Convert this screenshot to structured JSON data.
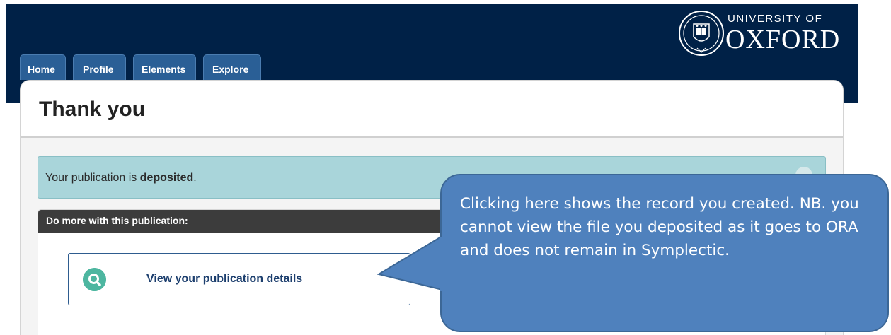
{
  "header": {
    "logo": {
      "line1": "UNIVERSITY OF",
      "line2": "OXFORD"
    }
  },
  "nav": {
    "tabs": [
      {
        "label": "Home"
      },
      {
        "label": "Profile"
      },
      {
        "label": "Elements"
      },
      {
        "label": "Explore"
      }
    ]
  },
  "main": {
    "title": "Thank you",
    "alert": {
      "prefix": "Your publication is ",
      "bold": "deposited",
      "suffix": "."
    },
    "more": {
      "title": "Do more with this publication:",
      "action_label": "View your publication details",
      "action_icon": "search-icon"
    }
  },
  "callout": {
    "text": "Clicking here shows the record you created. NB. you cannot view the file you deposited as it goes to ORA and does not remain in Symplectic."
  },
  "colors": {
    "brand_dark": "#002147",
    "tab": "#2a5f96",
    "alert_bg": "#a9d5da",
    "callout": "#4f81bd",
    "action_icon": "#4db6a0"
  }
}
